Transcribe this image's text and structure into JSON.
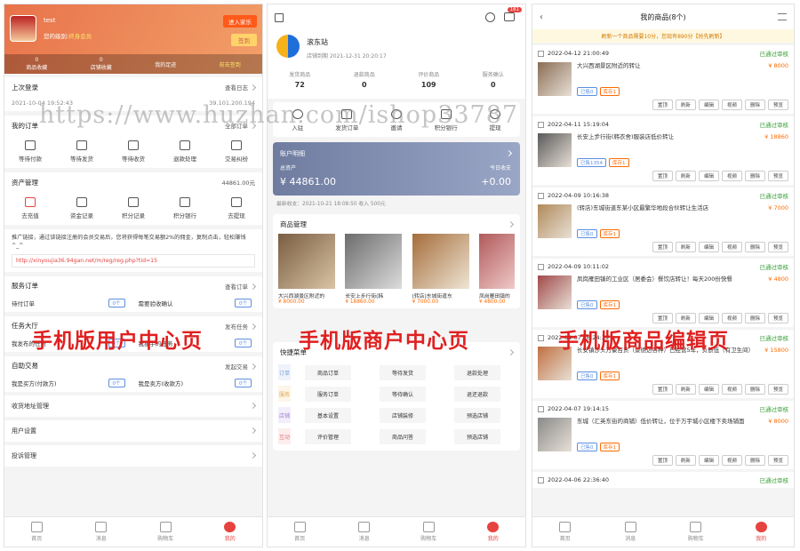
{
  "watermark": "https://www.huzhan.com/ishop33787",
  "labels": {
    "p1": "手机版用户中心页",
    "p2": "手机版商户中心页",
    "p3": "手机版商品编辑页"
  },
  "p1": {
    "user_name": "test",
    "member_text": "您的级别:",
    "member_level": "终身会员",
    "enter_shop_btn": "进入家乐",
    "signin_btn": "签到",
    "stats": [
      {
        "value": "0",
        "label": "商品收藏"
      },
      {
        "value": "0",
        "label": "店铺收藏"
      },
      {
        "value": "",
        "label": "我的足迹"
      },
      {
        "value": "",
        "label": "前去签到"
      }
    ],
    "last_login": {
      "title": "上次登录",
      "right": "查看日志",
      "time": "2021-10-04 19:52:43",
      "ip": "39.101.200.194"
    },
    "orders": {
      "title": "我的订单",
      "right": "全部订单",
      "items": [
        "等待付款",
        "等待发货",
        "等待收货",
        "退款处理",
        "交易纠纷"
      ]
    },
    "assets": {
      "title": "资产管理",
      "right": "44861.00元",
      "items": [
        "去充值",
        "资金记录",
        "积分记录",
        "积分银行",
        "去提现"
      ]
    },
    "promo_text": "推广链接，通过该链接注册的会员交易后，您将获得每笔交易额2%的佣金，复制点击，轻松赚钱^_^",
    "promo_link": "http://xinyoujia36.94gan.net/m/reg/reg.php?tid=15",
    "service": {
      "title": "服务订单",
      "right": "查看订单",
      "rows": [
        [
          "待付订单",
          "0个",
          "需要验收确认",
          "0个"
        ]
      ]
    },
    "tasks": {
      "title": "任务大厅",
      "right": "发布任务",
      "rows": [
        [
          "我发布的任务",
          "4个",
          "我接手的任务",
          "0个"
        ]
      ]
    },
    "auction": {
      "title": "自助交易",
      "right": "发起交易",
      "rows": [
        [
          "我是买方(付款方)",
          "0个",
          "我是卖方(收款方)",
          "0个"
        ]
      ]
    },
    "links": [
      "收货地址管理",
      "用户设置",
      "投诉管理"
    ]
  },
  "p2": {
    "shop_name": "滚东站",
    "shop_date_prefix": "店铺到期",
    "shop_date": "2021-12-31 20:20:17",
    "notify_count": "181",
    "stats": [
      {
        "label": "发货商品",
        "value": "72"
      },
      {
        "label": "退款商品",
        "value": "0"
      },
      {
        "label": "评价商品",
        "value": "109"
      },
      {
        "label": "服务确认",
        "value": "0"
      }
    ],
    "quick": [
      "入驻",
      "发货订单",
      "邀请",
      "积分银行",
      "提现"
    ],
    "account": {
      "title": "账户明细",
      "total_label": "总资产",
      "total": "¥ 44861.00",
      "today_label": "今日收支",
      "today": "+0.00",
      "recent": "最新收支：2021-10-21 18:08:50 收入 500元"
    },
    "products": {
      "title": "商品管理",
      "items": [
        {
          "name": "大兴西湖景区附近的",
          "price": "¥ 8000.00"
        },
        {
          "name": "长安上步行街(韩",
          "price": "¥ 18860.00"
        },
        {
          "name": "(转店)东城街道东",
          "price": "¥ 7000.00"
        },
        {
          "name": "凤岗雁田镇的",
          "price": "¥ 4800.00"
        }
      ]
    },
    "shortcuts": {
      "title": "快捷菜单",
      "groups": [
        {
          "tag": "订单",
          "items": [
            "商品订单",
            "等待发货",
            "退款处理"
          ]
        },
        {
          "tag": "服务",
          "items": [
            "服务订单",
            "等待确认",
            "退还退款"
          ]
        },
        {
          "tag": "店铺",
          "items": [
            "基本设置",
            "店铺装修",
            "预选店铺"
          ]
        },
        {
          "tag": "互动",
          "items": [
            "评价管理",
            "商品问答",
            "预选店铺"
          ]
        }
      ]
    }
  },
  "p3": {
    "title": "我的商品(8个)",
    "notice": "刷新一个商品需要10分，您现有890分【抢先刷新】",
    "cards": [
      {
        "date": "2022-04-12 21:00:49",
        "status": "已通过审核",
        "title": "大兴西湖景区附近的转让",
        "price": "¥ 8000",
        "tag1": "已售0",
        "tag2": "库存1"
      },
      {
        "date": "2022-04-11 15:19:04",
        "status": "已通过审核",
        "title": "长安上步行街(韩衣舍)服装店低价转让",
        "price": "¥ 18860",
        "tag1": "已售1354",
        "tag2": "库存1"
      },
      {
        "date": "2022-04-09 10:16:38",
        "status": "已通过审核",
        "title": "(转店)东城街道东某小区最繁华地段合伙转让生活店",
        "price": "¥ 7000",
        "tag1": "已售0",
        "tag2": "库存1"
      },
      {
        "date": "2022-04-09 10:11:02",
        "status": "已通过审核",
        "title": "凤岗雁田镇的工业区（居委会）餐饮店转让！每天200份快餐",
        "price": "¥ 4800",
        "tag1": "已售0",
        "tag2": "库存1"
      },
      {
        "date": "2022-04-07 16:24:39",
        "status": "已通过审核",
        "title": "长安镇沙头万豪百货（景德达各种）已经营5年，负债低（有卫生间）",
        "price": "¥ 15800",
        "tag1": "已售0",
        "tag2": "库存1"
      },
      {
        "date": "2022-04-07 19:14:15",
        "status": "已通过审核",
        "title": "东城（汇英东街的商铺）低价转让，位于万宇城小区楼下卖场铺面",
        "price": "¥ 8000",
        "tag1": "已售0",
        "tag2": "库存1"
      },
      {
        "date": "2022-04-06 22:36:40",
        "status": "已通过审核",
        "title": "",
        "price": "",
        "tag1": "",
        "tag2": ""
      }
    ],
    "buttons": [
      "置顶",
      "刷新",
      "编辑",
      "视频",
      "删除",
      "预览"
    ]
  },
  "tabbar1": [
    "首页",
    "消息",
    "购物车",
    "我的"
  ],
  "tabbar2": [
    "首页",
    "消息",
    "购物车",
    "我的"
  ],
  "tabbar3": [
    "首页",
    "消息",
    "购物车",
    "我的"
  ]
}
